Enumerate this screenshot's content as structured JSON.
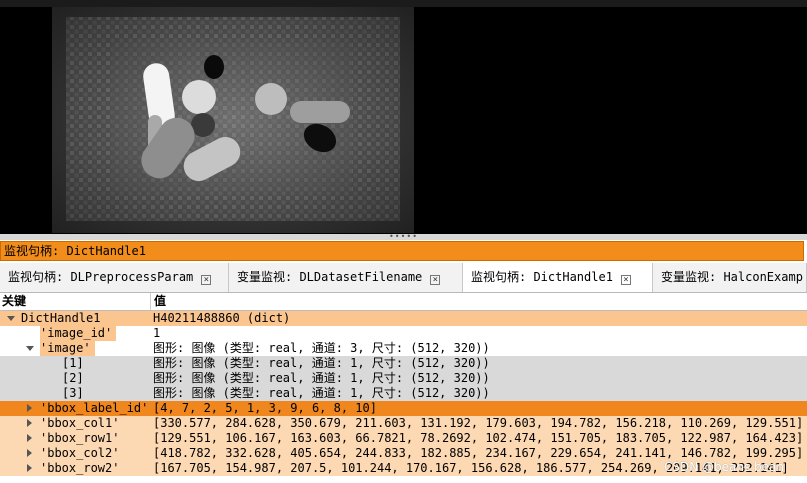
{
  "colors": {
    "accent": "#f28c1a",
    "row_highlight": "#fbc58f",
    "row_selected": "#f0861e",
    "row_gray": "#d9d9d9"
  },
  "monitor_title": "监视句柄: DictHandle1",
  "tabs": [
    {
      "label": "监视句柄: DLPreprocessParam",
      "close_icon": "close-icon",
      "active": false
    },
    {
      "label": "变量监视: DLDatasetFilename",
      "close_icon": "close-icon",
      "active": false
    },
    {
      "label": "监视句柄: DictHandle1",
      "close_icon": "close-icon",
      "active": true
    },
    {
      "label": "变量监视: HalconExamp",
      "close_icon": "",
      "active": false
    }
  ],
  "columns": {
    "key": "关键",
    "value": "值"
  },
  "rows": [
    {
      "key": "DictHandle1",
      "value": "H40211488860 (dict)"
    },
    {
      "key": "'image_id'",
      "value": "1"
    },
    {
      "key": "'image'",
      "value": "图形: 图像 (类型: real, 通道: 3, 尺寸: (512, 320))"
    },
    {
      "key": "[1]",
      "value": "图形: 图像 (类型: real, 通道: 1, 尺寸: (512, 320))"
    },
    {
      "key": "[2]",
      "value": "图形: 图像 (类型: real, 通道: 1, 尺寸: (512, 320))"
    },
    {
      "key": "[3]",
      "value": "图形: 图像 (类型: real, 通道: 1, 尺寸: (512, 320))"
    },
    {
      "key": "'bbox_label_id'",
      "value": "[4, 7, 2, 5, 1, 3, 9, 6, 8, 10]"
    },
    {
      "key": "'bbox_col1'",
      "value": "[330.577, 284.628, 350.679, 211.603, 131.192, 179.603, 194.782, 156.218, 110.269, 129.551]"
    },
    {
      "key": "'bbox_row1'",
      "value": "[129.551, 106.167, 163.603, 66.7821, 78.2692, 102.474, 151.705, 183.705, 122.987, 164.423]"
    },
    {
      "key": "'bbox_col2'",
      "value": "[418.782, 332.628, 405.654, 244.833, 182.885, 234.167, 229.654, 241.141, 146.782, 199.295]"
    },
    {
      "key": "'bbox_row2'",
      "value": "[167.705, 154.987, 207.5, 101.244, 170.167, 156.628, 186.577, 254.269, 209.141, 232.141]"
    }
  ],
  "watermark": "CSDN @beans bean"
}
